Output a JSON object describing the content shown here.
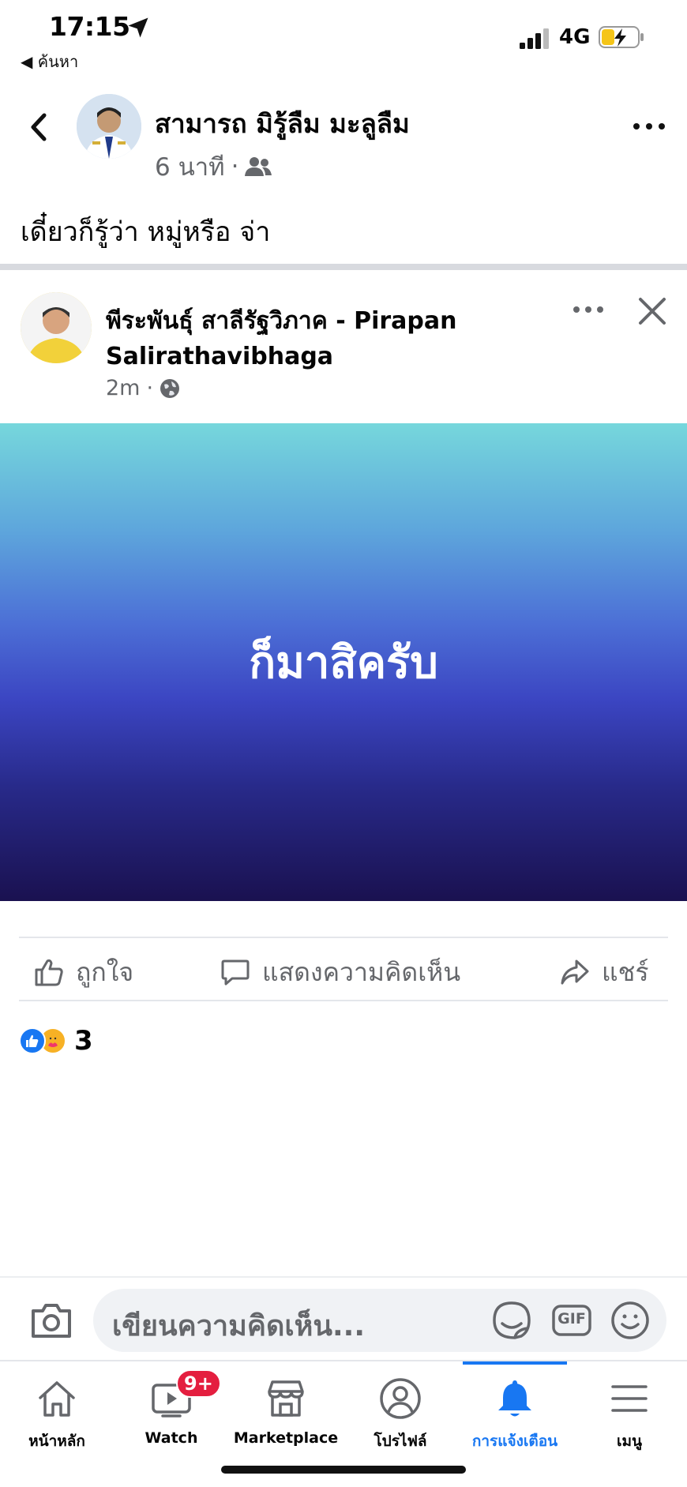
{
  "status_bar": {
    "time": "17:15",
    "back_app": "◀ ค้นหา",
    "network": "4G"
  },
  "post": {
    "author": "สามารถ มิรู้ลืม มะลูลืม",
    "time": "6 นาที",
    "separator": "·",
    "audience_icon": "friends-icon",
    "text": "เดี๋ยวก็รู้ว่า หมู่หรือ จ่า"
  },
  "shared_post": {
    "author": "พีระพันธุ์ สาลีรัฐวิภาค - Pirapan Salirathavibhaga",
    "time": "2m",
    "separator": "·",
    "audience_icon": "globe-icon",
    "banner_text": "ก็มาสิครับ",
    "banner_colors": [
      "#76d7dc",
      "#4c6fd6",
      "#1a1150"
    ]
  },
  "actions": {
    "like": "ถูกใจ",
    "comment": "แสดงความคิดเห็น",
    "share": "แชร์"
  },
  "reactions": {
    "count": "3",
    "types": [
      "like",
      "care"
    ]
  },
  "composer": {
    "placeholder": "เขียนความคิดเห็น...",
    "gif_label": "GIF"
  },
  "tabs": [
    {
      "label": "หน้าหลัก",
      "icon": "home-icon"
    },
    {
      "label": "Watch",
      "icon": "watch-icon",
      "badge": "9+"
    },
    {
      "label": "Marketplace",
      "icon": "marketplace-icon"
    },
    {
      "label": "โปรไฟล์",
      "icon": "profile-icon"
    },
    {
      "label": "การแจ้งเตือน",
      "icon": "bell-icon",
      "active": true
    },
    {
      "label": "เมนู",
      "icon": "menu-icon"
    }
  ],
  "colors": {
    "accent": "#1877f2",
    "badge": "#e41e3f",
    "secondary_text": "#65676b"
  }
}
